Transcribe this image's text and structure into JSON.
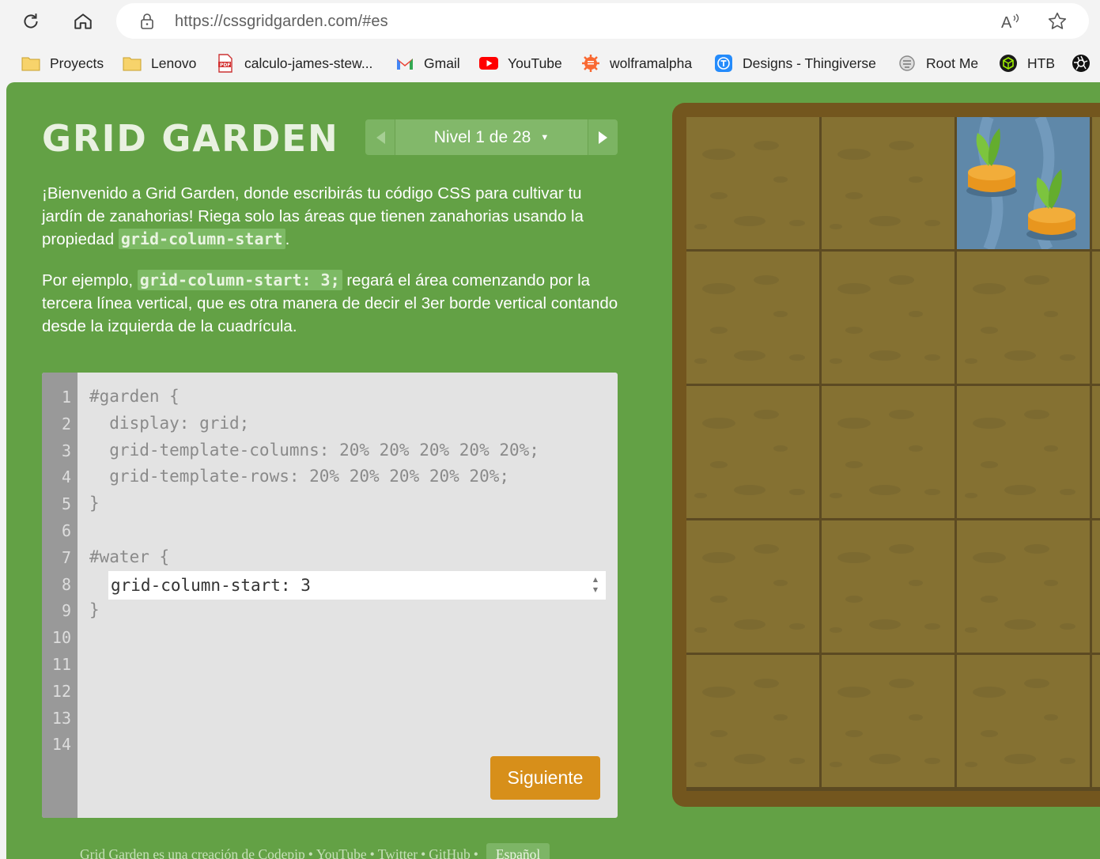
{
  "browser": {
    "url": "https://cssgridgarden.com/#es",
    "bookmarks": [
      {
        "label": "Proyects",
        "icon": "folder-icon"
      },
      {
        "label": "Lenovo",
        "icon": "folder-icon"
      },
      {
        "label": "calculo-james-stew...",
        "icon": "pdf-icon"
      },
      {
        "label": "Gmail",
        "icon": "gmail-icon"
      },
      {
        "label": "YouTube",
        "icon": "youtube-icon"
      },
      {
        "label": "wolframalpha",
        "icon": "wolframalpha-icon"
      },
      {
        "label": "Designs - Thingiverse",
        "icon": "thingiverse-icon"
      },
      {
        "label": "Root Me",
        "icon": "rootme-icon"
      },
      {
        "label": "HTB",
        "icon": "htb-icon"
      }
    ]
  },
  "game": {
    "title": "GRID GARDEN",
    "level_label": "Nivel 1 de 28",
    "intro": {
      "p1_before": "¡Bienvenido a Grid Garden, donde escribirás tu código CSS para cultivar tu jardín de zanahorias! Riega solo las áreas que tienen zanahorias usando la propiedad ",
      "p1_code": "grid-column-start",
      "p1_after": ".",
      "p2_before": "Por ejemplo, ",
      "p2_code": "grid-column-start: 3;",
      "p2_after": " regará el área comenzando por la tercera línea vertical, que es otra manera de decir el 3er borde vertical contando desde la izquierda de la cuadrícula."
    },
    "editor": {
      "line_numbers": [
        "1",
        "2",
        "3",
        "4",
        "5",
        "6",
        "7",
        "8",
        "9",
        "10",
        "11",
        "12",
        "13",
        "14"
      ],
      "lines": {
        "l1": "#garden {",
        "l2": "  display: grid;",
        "l3": "  grid-template-columns: 20% 20% 20% 20% 20%;",
        "l4": "  grid-template-rows: 20% 20% 20% 20% 20%;",
        "l5": "}",
        "l7": "#water {",
        "l9": "}"
      },
      "input_value": "grid-column-start: 3",
      "next_button": "Siguiente"
    },
    "footer": {
      "text": "Grid Garden es una creación de",
      "links": [
        "Codepip",
        "YouTube",
        "Twitter",
        "GitHub"
      ],
      "language": "Español"
    }
  },
  "colors": {
    "page_bg": "#63a145",
    "soil": "#857132",
    "water": "#5f88a9",
    "carrot": "#e8961e",
    "button": "#d78f1a"
  }
}
